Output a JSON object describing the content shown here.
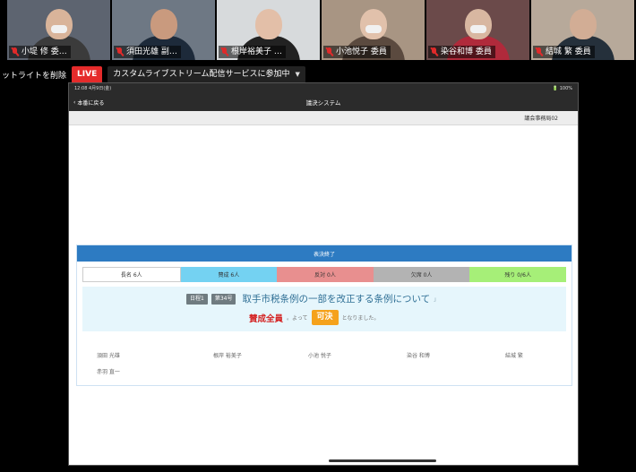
{
  "participants": [
    {
      "name": "小堤 修 委…",
      "skin": "#d9b49a",
      "shirt": "#3b3b3b",
      "bg": "#5d6470",
      "mask": true
    },
    {
      "name": "須田光雄 副…",
      "skin": "#c99a7e",
      "shirt": "#1d2a3a",
      "bg": "#6e7884",
      "mask": false
    },
    {
      "name": "根岸裕美子 …",
      "skin": "#e3bfa8",
      "shirt": "#222222",
      "bg": "#d7dadc",
      "mask": false
    },
    {
      "name": "小池悦子 委員",
      "skin": "#e1c1ab",
      "shirt": "#5b4a3f",
      "bg": "#a89583",
      "mask": true
    },
    {
      "name": "染谷和博 委員",
      "skin": "#d8b7a1",
      "shirt": "#b02a3b",
      "bg": "#6b4a4a",
      "mask": true
    },
    {
      "name": "結城 繁 委員",
      "skin": "#d2ad95",
      "shirt": "#25303b",
      "bg": "#b7a99a",
      "mask": false
    }
  ],
  "live": {
    "remove_label": "ットライトを削除",
    "badge": "LIVE",
    "status": "カスタムライブストリーム配信サービスに参加中"
  },
  "tablet": {
    "status_time": "12:08  4月9日(金)",
    "status_battery": "🔋 100%",
    "back_label": "本番に戻る",
    "title": "議決システム",
    "user": "議会事務局02",
    "panel_title": "表決終了",
    "tally": {
      "total": "長名 6人",
      "yes": "賛成 6人",
      "no": "反対 0人",
      "absent": "欠席 0人",
      "remaining": "残り 0/6人"
    },
    "bill": {
      "tag1": "日程1",
      "tag2": "第34号",
      "title": "取手市税条例の一部を改正する条例について",
      "mark": "」",
      "result": "賛成全員",
      "by": "。よって",
      "outcome": "可決",
      "end": "となりました。"
    },
    "members": [
      "須田 光雄",
      "根岸 裕美子",
      "小池 悦子",
      "染谷 和博",
      "結城 繁",
      "赤羽 直一"
    ]
  },
  "colors": {
    "live": "#e52b2b",
    "panel_header": "#2d7bc2",
    "yes": "#74d2f2",
    "no": "#e88f8f",
    "absent": "#b3b3b3",
    "remaining": "#a6ef78",
    "passed": "#f5a21c",
    "result": "#d42424"
  }
}
